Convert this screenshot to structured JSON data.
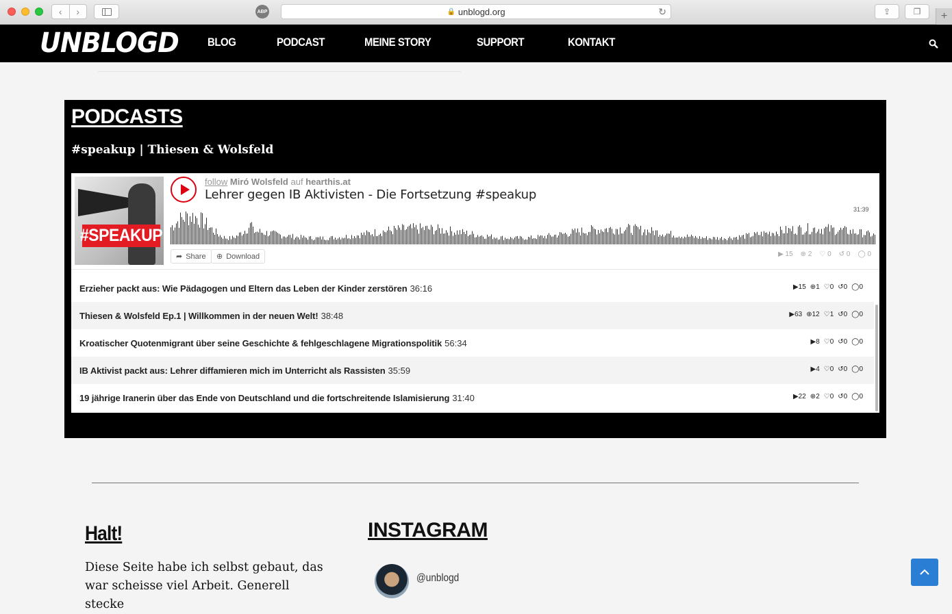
{
  "browser": {
    "url": "unblogd.org",
    "abp_label": "ABP"
  },
  "site": {
    "logo": "UNBLOGD",
    "nav": [
      "BLOG",
      "PODCAST",
      "MEINE STORY",
      "SUPPORT",
      "KONTAKT"
    ]
  },
  "podcasts": {
    "title": "PODCASTS",
    "subtitle": "#speakup | Thiesen & Wolsfeld",
    "player": {
      "cover_tag": "#SPEAKUP",
      "follow": "follow",
      "author": "Miró Wolsfeld",
      "on": "auf",
      "platform": "hearthis.at",
      "track_title": "Lehrer gegen IB Aktivisten - Die Fortsetzung #speakup",
      "duration": "31:39",
      "share_label": "Share",
      "download_label": "Download",
      "stats": {
        "plays": "15",
        "downloads": "2",
        "likes": "0",
        "reposts": "0",
        "comments": "0"
      }
    },
    "tracks": [
      {
        "title": "Erzieher packt aus: Wie Pädagogen und Eltern das Leben der Kinder zerstören",
        "duration": "36:16",
        "plays": "15",
        "downloads": "1",
        "likes": "0",
        "reposts": "0",
        "comments": "0"
      },
      {
        "title": "Thiesen & Wolsfeld Ep.1 | Willkommen in der neuen Welt!",
        "duration": "38:48",
        "plays": "63",
        "downloads": "12",
        "likes": "1",
        "reposts": "0",
        "comments": "0"
      },
      {
        "title": "Kroatischer Quotenmigrant über seine Geschichte & fehlgeschlagene Migrationspolitik",
        "duration": "56:34",
        "plays": "8",
        "downloads": "",
        "likes": "0",
        "reposts": "0",
        "comments": "0"
      },
      {
        "title": "IB Aktivist packt aus: Lehrer diffamieren mich im Unterricht als Rassisten",
        "duration": "35:59",
        "plays": "4",
        "downloads": "",
        "likes": "0",
        "reposts": "0",
        "comments": "0"
      },
      {
        "title": "19 jährige Iranerin über das Ende von Deutschland und die fortschreitende Islamisierung",
        "duration": "31:40",
        "plays": "22",
        "downloads": "2",
        "likes": "0",
        "reposts": "0",
        "comments": "0"
      }
    ]
  },
  "halt": {
    "title": "Halt!",
    "text": "Diese Seite habe ich selbst gebaut, das war scheisse viel Arbeit. Generell stecke"
  },
  "instagram": {
    "title": "INSTAGRAM",
    "handle": "@unblogd"
  },
  "icons": {
    "play": "play-icon",
    "search": "search-icon",
    "back_to_top": "chevron-up-icon"
  },
  "colors": {
    "accent_red": "#e31b23",
    "header_bg": "#000000",
    "back_to_top": "#2a7fd4"
  }
}
